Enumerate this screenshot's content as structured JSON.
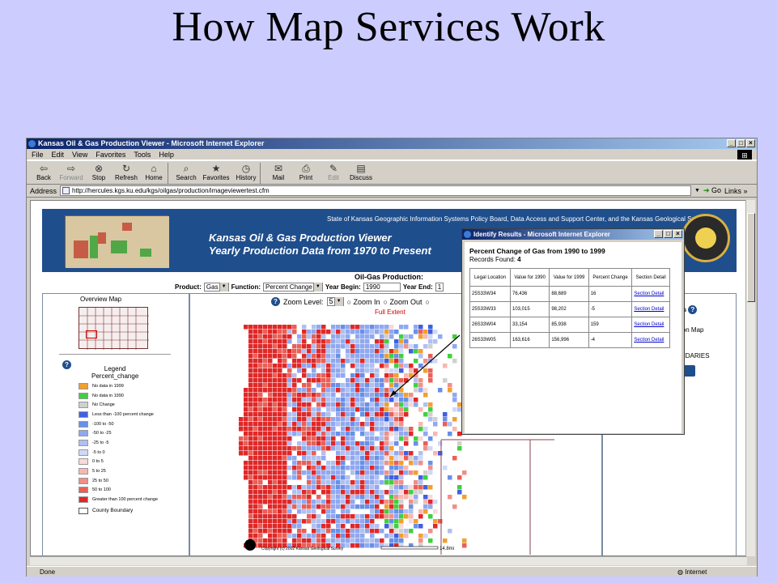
{
  "slide": {
    "title": "How Map Services Work"
  },
  "browser": {
    "window_title": "Kansas Oil & Gas Production Viewer - Microsoft Internet Explorer",
    "menu": [
      "File",
      "Edit",
      "View",
      "Favorites",
      "Tools",
      "Help"
    ],
    "toolbar": [
      {
        "label": "Back",
        "icon": "back-arrow-icon"
      },
      {
        "label": "Forward",
        "icon": "forward-arrow-icon",
        "disabled": true
      },
      {
        "label": "Stop",
        "icon": "stop-icon"
      },
      {
        "label": "Refresh",
        "icon": "refresh-icon"
      },
      {
        "label": "Home",
        "icon": "home-icon"
      },
      {
        "label": "Search",
        "icon": "search-icon"
      },
      {
        "label": "Favorites",
        "icon": "favorites-icon"
      },
      {
        "label": "History",
        "icon": "history-icon"
      },
      {
        "label": "Mail",
        "icon": "mail-icon"
      },
      {
        "label": "Print",
        "icon": "print-icon"
      },
      {
        "label": "Edit",
        "icon": "edit-icon",
        "disabled": true
      },
      {
        "label": "Discuss",
        "icon": "discuss-icon"
      }
    ],
    "address_label": "Address",
    "address_url": "http://hercules.kgs.ku.edu/kgs/oilgas/production/imageviewertest.cfm",
    "go_label": "Go",
    "links_label": "Links »",
    "status_text": "Done",
    "zone_text": "Internet"
  },
  "app": {
    "credit": "State of Kansas Geographic Information Systems Policy Board, Data Access and Support Center, and the Kansas Geological Survey",
    "title_line1": "Kansas Oil & Gas Production Viewer",
    "title_line2": "Yearly Production Data from 1970 to Present",
    "production_label": "Oil-Gas Production:",
    "product_label": "Product:",
    "product_value": "Gas",
    "function_label": "Function:",
    "function_value": "Percent Change",
    "year_begin_label": "Year Begin:",
    "year_begin_value": "1990",
    "year_end_label": "Year End:",
    "year_end_value": "1",
    "overview_title": "Overview Map",
    "legend_title": "Legend",
    "legend_subtitle": "Percent_change",
    "legend_items": [
      {
        "label": "No data in 1999",
        "color": "#f0a030"
      },
      {
        "label": "No data in 1990",
        "color": "#40d040"
      },
      {
        "label": "No Change",
        "color": "#d0d0d0"
      },
      {
        "label": "Less than -100 percent change",
        "color": "#4060e0"
      },
      {
        "label": "-100 to -50",
        "color": "#6890e8"
      },
      {
        "label": "-50 to -25",
        "color": "#90a8f0"
      },
      {
        "label": "-25 to -5",
        "color": "#b0c0f0"
      },
      {
        "label": "-5 to 0",
        "color": "#d0d8f8"
      },
      {
        "label": "0 to 5",
        "color": "#f8d8d8"
      },
      {
        "label": "5 to 25",
        "color": "#f8b8b0"
      },
      {
        "label": "25 to 50",
        "color": "#f09088"
      },
      {
        "label": "50 to 100",
        "color": "#e86058"
      },
      {
        "label": "Greater than 100 percent change",
        "color": "#e02828"
      }
    ],
    "county_boundary_label": "County Boundary",
    "zoom_level_label": "Zoom Level:",
    "zoom_level_value": "5",
    "zoom_in_label": "Zoom In",
    "zoom_out_label": "Zoom Out",
    "full_extent_label": "Full Extent",
    "copyright": "Copyright (c) 2002 Kansas Geological Survey",
    "scale_label": "14.8mi",
    "right_panel": {
      "line1": "ts",
      "line2": "ion Map",
      "line3": "NDARIES"
    }
  },
  "popup": {
    "window_title": "Identify Results - Microsoft Internet Explorer",
    "heading": "Percent Change of Gas from 1990 to 1999",
    "records_label": "Records Found:",
    "records_count": "4",
    "columns": [
      "Legal Location",
      "Value for 1990",
      "Value for 1999",
      "Percent Change",
      "Section Detail"
    ],
    "rows": [
      {
        "location": "25S33W34",
        "v1990": "76,436",
        "v1999": "88,689",
        "pct": "16",
        "link": "Section Detail"
      },
      {
        "location": "25S33W33",
        "v1990": "103,015",
        "v1999": "98,202",
        "pct": "-5",
        "link": "Section Detail"
      },
      {
        "location": "26S33W04",
        "v1990": "33,154",
        "v1999": "85,938",
        "pct": "159",
        "link": "Section Detail"
      },
      {
        "location": "26S33W05",
        "v1990": "163,616",
        "v1999": "156,996",
        "pct": "-4",
        "link": "Section Detail"
      }
    ]
  }
}
